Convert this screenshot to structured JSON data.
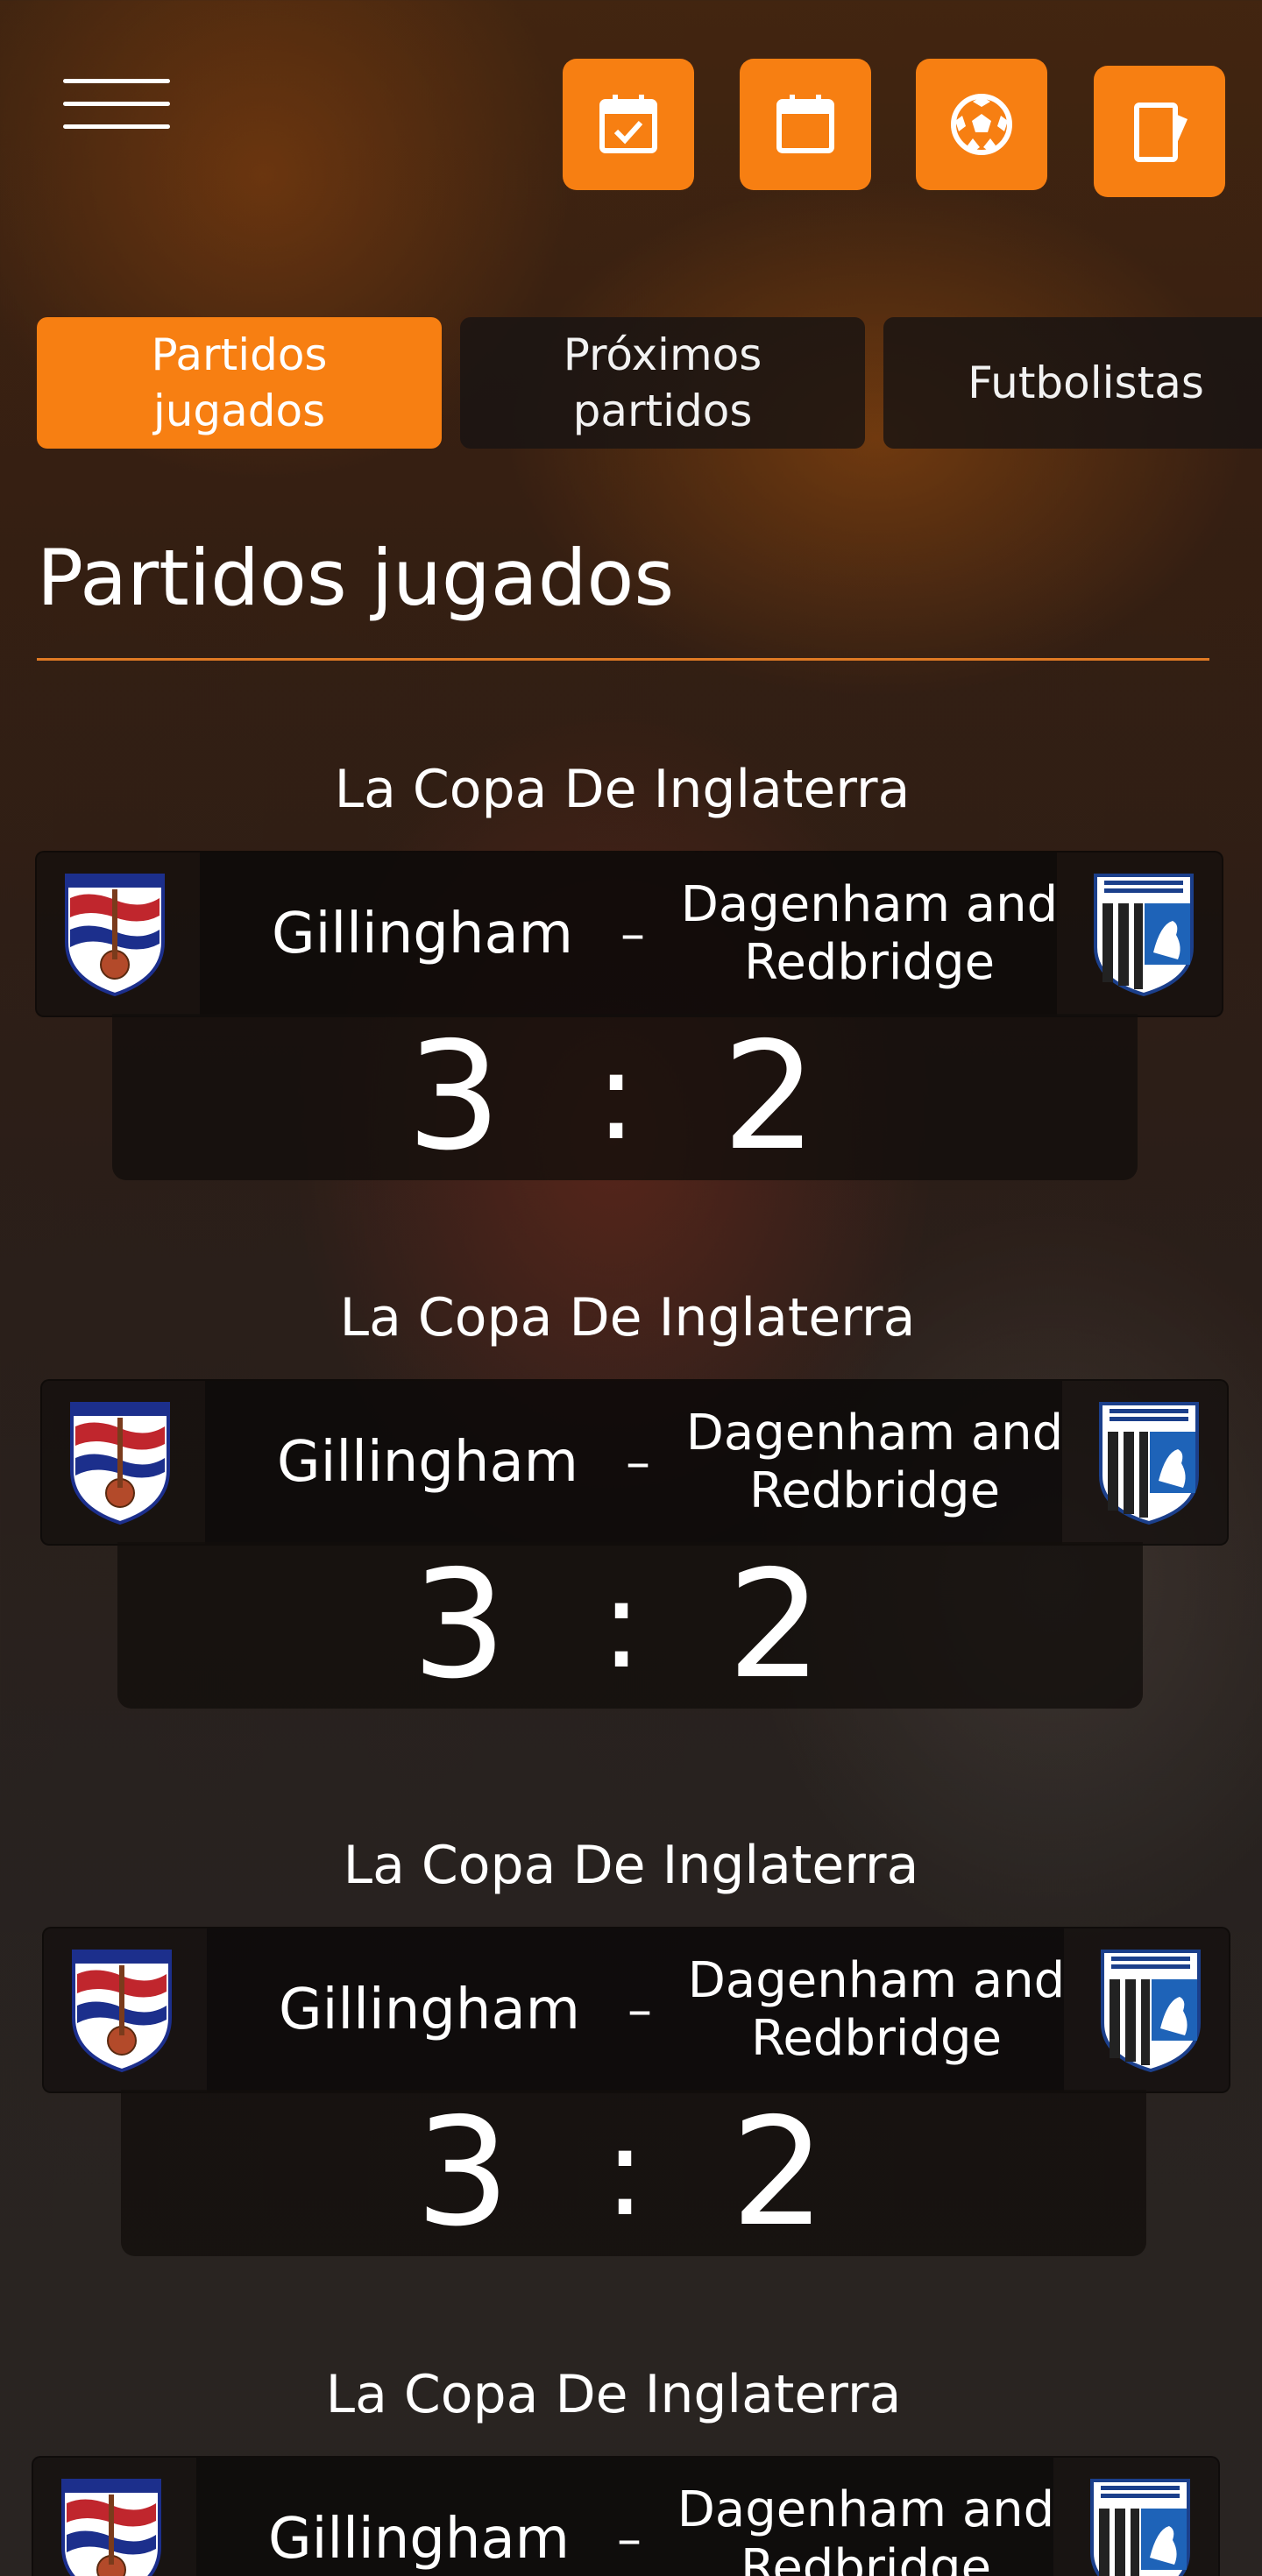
{
  "header": {
    "menu_icon": "hamburger-menu-icon",
    "nav_icons": [
      "calendar-check-icon",
      "calendar-icon",
      "soccer-ball-icon",
      "red-card-icon"
    ],
    "accent_color": "#f77f12"
  },
  "tabs": [
    {
      "label": "Partidos\njugados",
      "active": true
    },
    {
      "label": "Próximos\npartidos",
      "active": false
    },
    {
      "label": "Futbolistas",
      "active": false
    }
  ],
  "page_title": "Partidos jugados",
  "matches": [
    {
      "competition": "La Copa De Inglaterra",
      "home": "Gillingham",
      "separator": "–",
      "away": "Dagenham and\nRedbridge",
      "score_home": "3",
      "score_sep": ":",
      "score_away": "2"
    },
    {
      "competition": "La Copa De Inglaterra",
      "home": "Gillingham",
      "separator": "–",
      "away": "Dagenham and\nRedbridge",
      "score_home": "3",
      "score_sep": ":",
      "score_away": "2"
    },
    {
      "competition": "La Copa De Inglaterra",
      "home": "Gillingham",
      "separator": "–",
      "away": "Dagenham and\nRedbridge",
      "score_home": "3",
      "score_sep": ":",
      "score_away": "2"
    },
    {
      "competition": "La Copa De Inglaterra",
      "home": "Gillingham",
      "separator": "–",
      "away": "Dagenham and\nRedbridge",
      "score_home": "",
      "score_sep": "",
      "score_away": ""
    }
  ],
  "crests": {
    "left": "dagenham-redbridge-crest",
    "right": "gillingham-fc-crest"
  }
}
